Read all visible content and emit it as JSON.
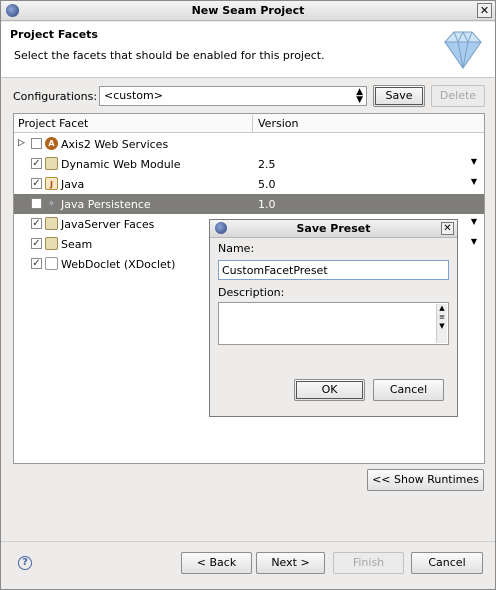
{
  "window": {
    "title": "New Seam Project",
    "close_label": "✕"
  },
  "header": {
    "title": "Project Facets",
    "subtitle": "Select the facets that should be enabled for this project."
  },
  "configurations": {
    "label": "Configurations:",
    "selected": "<custom>",
    "save_label": "Save",
    "delete_label": "Delete"
  },
  "facets_table": {
    "columns": [
      "Project Facet",
      "Version"
    ],
    "rows": [
      {
        "name": "Axis2 Web Services",
        "version": "",
        "checked": false,
        "expandable": true,
        "icon": "axis2-icon",
        "has_dropdown": false,
        "selected": false
      },
      {
        "name": "Dynamic Web Module",
        "version": "2.5",
        "checked": true,
        "expandable": false,
        "icon": "web-module-icon",
        "has_dropdown": true,
        "selected": false
      },
      {
        "name": "Java",
        "version": "5.0",
        "checked": true,
        "expandable": false,
        "icon": "java-icon",
        "has_dropdown": true,
        "selected": false
      },
      {
        "name": "Java Persistence",
        "version": "1.0",
        "checked": false,
        "expandable": false,
        "icon": "jpa-icon",
        "has_dropdown": false,
        "selected": true
      },
      {
        "name": "JavaServer Faces",
        "version": "",
        "checked": true,
        "expandable": false,
        "icon": "jsf-icon",
        "has_dropdown": true,
        "selected": false
      },
      {
        "name": "Seam",
        "version": "",
        "checked": true,
        "expandable": false,
        "icon": "seam-icon",
        "has_dropdown": true,
        "selected": false
      },
      {
        "name": "WebDoclet (XDoclet)",
        "version": "",
        "checked": true,
        "expandable": false,
        "icon": "xdoclet-icon",
        "has_dropdown": false,
        "selected": false
      }
    ]
  },
  "dialog": {
    "title": "Save Preset",
    "name_label": "Name:",
    "name_value": "CustomFacetPreset",
    "description_label": "Description:",
    "description_value": "",
    "ok_label": "OK",
    "cancel_label": "Cancel"
  },
  "show_runtimes_label": "<< Show Runtimes",
  "footer": {
    "back_label": "< Back",
    "next_label": "Next >",
    "finish_label": "Finish",
    "cancel_label": "Cancel"
  },
  "colors": {
    "selection_row": "#7f7d79",
    "focus_border": "#7da2ce",
    "window_bg": "#edeceb"
  }
}
